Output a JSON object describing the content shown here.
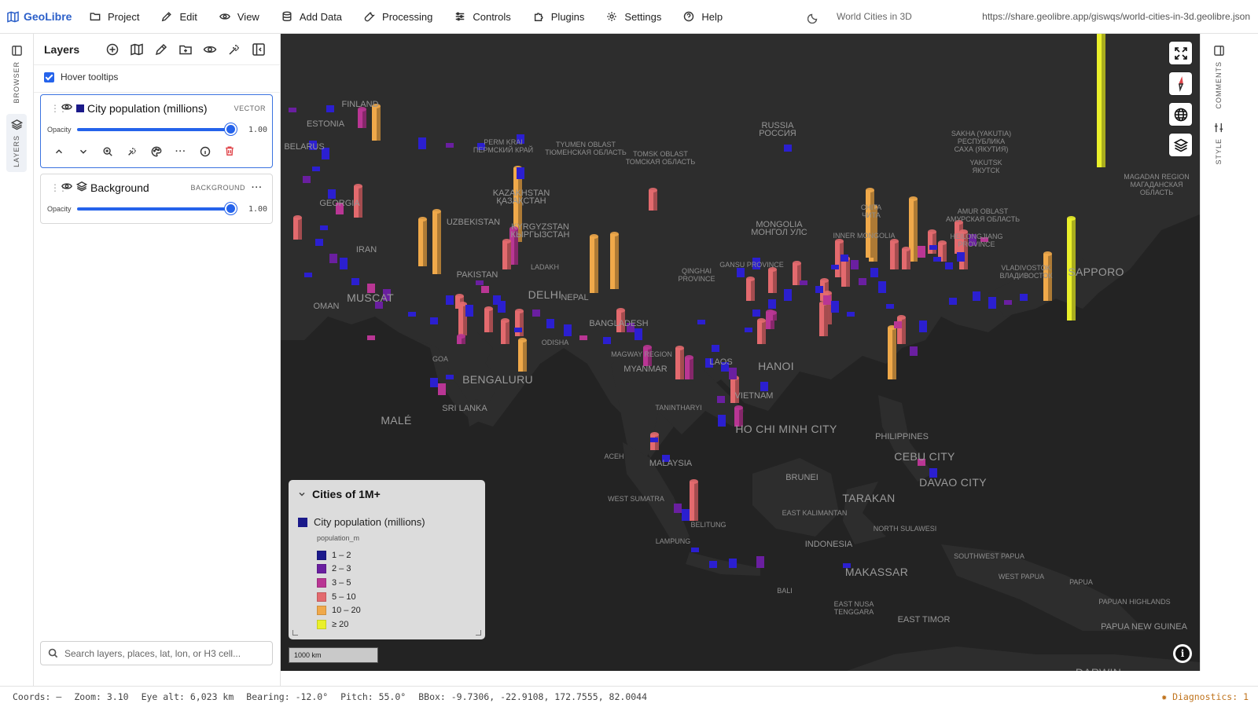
{
  "app": {
    "name": "GeoLibre",
    "project_title": "World Cities in 3D",
    "share_url": "https://share.geolibre.app/giswqs/world-cities-in-3d.geolibre.json"
  },
  "menu": [
    {
      "label": "Project",
      "icon": "folder-icon"
    },
    {
      "label": "Edit",
      "icon": "pencil-icon"
    },
    {
      "label": "View",
      "icon": "eye-icon"
    },
    {
      "label": "Add Data",
      "icon": "database-icon"
    },
    {
      "label": "Processing",
      "icon": "wrench-icon"
    },
    {
      "label": "Controls",
      "icon": "sliders-icon"
    },
    {
      "label": "Plugins",
      "icon": "puzzle-icon"
    },
    {
      "label": "Settings",
      "icon": "gear-icon"
    },
    {
      "label": "Help",
      "icon": "help-icon"
    }
  ],
  "left_rail": {
    "browser": "BROWSER",
    "layers": "LAYERS"
  },
  "right_rail": {
    "comments": "COMMENTS",
    "style": "STYLE"
  },
  "layers_panel": {
    "title": "Layers",
    "hover_tooltips": "Hover tooltips",
    "hover_tooltips_checked": true,
    "layers": [
      {
        "name": "City population (millions)",
        "type": "VECTOR",
        "opacity_label": "Opacity",
        "opacity": "1.00",
        "swatch": "#1b1a8a",
        "selected": true
      },
      {
        "name": "Background",
        "type": "BACKGROUND",
        "opacity_label": "Opacity",
        "opacity": "1.00",
        "selected": false
      }
    ],
    "search_placeholder": "Search layers, places, lat, lon, or H3 cell..."
  },
  "legend": {
    "title": "Cities of 1M+",
    "layer_name": "City population (millions)",
    "field": "population_m",
    "bins": [
      {
        "label": "1 – 2",
        "color": "#1c1a8c"
      },
      {
        "label": "2 – 3",
        "color": "#6a1fa0"
      },
      {
        "label": "3 – 5",
        "color": "#b93694"
      },
      {
        "label": "5 – 10",
        "color": "#e36a6e"
      },
      {
        "label": "10 – 20",
        "color": "#f0a94a"
      },
      {
        "label": "≥ 20",
        "color": "#eaf02a"
      }
    ]
  },
  "scale": "1000 km",
  "map_labels": {
    "countries": [
      "RUSSIA\nРОССИЯ",
      "IRAN",
      "OMAN",
      "PAKISTAN",
      "NEPAL",
      "BANGLADESH",
      "MYANMAR",
      "LAOS",
      "VIETNAM",
      "MALAYSIA",
      "INDONESIA",
      "PHILIPPINES",
      "BRUNEI",
      "EAST TIMOR",
      "SRI LANKA",
      "PAPUA NEW GUINEA",
      "MONGOLIA\nМОНГОЛ УЛС",
      "UZBEKISTAN",
      "KYRGYZSTAN\nКЫРГЫЗСТАН",
      "KAZAKHSTAN\nҚАЗАҚСТАН",
      "GEORGIA",
      "ESTONIA",
      "FINLAND",
      "BELARUS"
    ],
    "cities": [
      "BENGALURU",
      "HO CHI MINH CITY",
      "HANOI",
      "SAPPORO",
      "DELHI",
      "CEBU CITY",
      "DAVAO CITY",
      "MAKASSAR",
      "TARAKAN",
      "MUSCAT",
      "MALÉ",
      "DARWIN"
    ],
    "regions": [
      "WEST SUMATRA",
      "EAST KALIMANTAN",
      "NORTH SULAWESI",
      "SOUTHWEST PAPUA",
      "WEST PAPUA",
      "PAPUA",
      "PAPUAN HIGHLANDS",
      "EAST NUSA\nTENGGARA",
      "BALI",
      "TANINTHARYI",
      "MAGWAY REGION",
      "ODISHA",
      "GOA",
      "ACEH",
      "BELITUNG",
      "LAMPUNG",
      "LADAKH",
      "GANSU PROVINCE",
      "QINGHAI\nPROVINCE",
      "INNER MONGOLIA",
      "HEILONGJIANG\nPROVINCE",
      "AMUR OBLAST\nАМУРСКАЯ ОБЛАСТЬ",
      "SAKHA (YAKUTIA)\nРЕСПУБЛИКА\nСАХА (ЯКУТИЯ)",
      "TOMSK OBLAST\nТОМСКАЯ ОБЛАСТЬ",
      "TYUMEN OBLAST\nТЮМЕНСКАЯ ОБЛАСТЬ",
      "PERM KRAI\nПЕРМСКИЙ КРАЙ",
      "MAGADAN REGION\nМАГАДАНСКАЯ\nОБЛАСТЬ",
      "VLADIVOSTOK\nВЛАДИВОСТОК",
      "CHITA\nЧИТА",
      "YAKUTSK\nЯКУТСК"
    ]
  },
  "status": {
    "coords": "Coords: —",
    "zoom": "Zoom: 3.10",
    "eye_alt": "Eye alt: 6,023 km",
    "bearing": "Bearing: -12.0°",
    "pitch": "Pitch: 55.0°",
    "bbox": "BBox: -9.7306, -22.9108, 172.7555, 82.0044",
    "diagnostics": "Diagnostics: 1"
  },
  "colors": {
    "accent": "#2563eb",
    "brand": "#2b5fc9",
    "map_bg": "#232323",
    "danger": "#e0464b",
    "warning": "#c0741e"
  }
}
